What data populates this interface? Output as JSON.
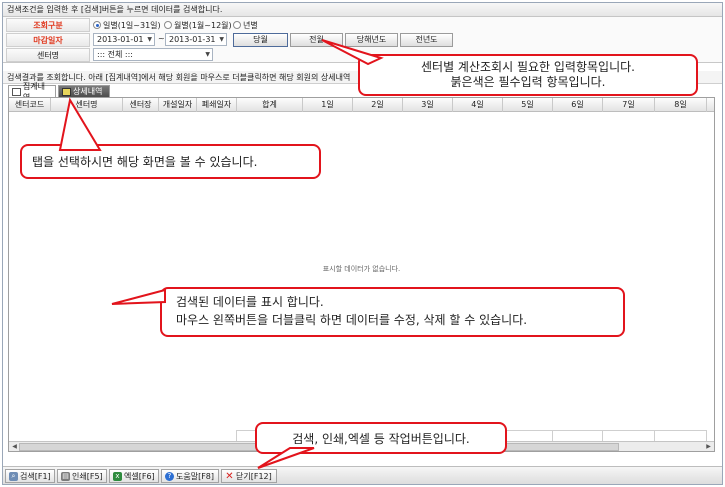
{
  "header": {
    "instruction": "검색조건을 입력한 후 [검색]버튼을 누르면 데이터를 검색합니다."
  },
  "search": {
    "period_type_label": "조회구분",
    "period_options": [
      "일별(1일~31일)",
      "월별(1월~12월)",
      "년별"
    ],
    "selected_period": "일별(1일~31일)",
    "close_date_label": "마감일자",
    "date_from": "2013-01-01",
    "date_separator": "~",
    "date_to": "2013-01-31",
    "quick_buttons": [
      "당월",
      "전월",
      "당해년도",
      "전년도"
    ],
    "center_label": "센터명",
    "center_value": "::: 전체 :::"
  },
  "result": {
    "info": "검색결과를 조회합니다. 아래 [집계내역]에서 해당 회원을 마우스로 더블클릭하면 해당 회원의 상세내역"
  },
  "tabs": [
    {
      "label": "집계내역",
      "active": true
    },
    {
      "label": "상세내역",
      "active": false
    }
  ],
  "grid": {
    "columns": [
      "센터코드",
      "센터명",
      "센터장",
      "개설일자",
      "폐쇄일자",
      "합계",
      "1일",
      "2일",
      "3일",
      "4일",
      "5일",
      "6일",
      "7일",
      "8일"
    ],
    "empty_message": "표시할 데이터가 없습니다."
  },
  "toolbar": {
    "buttons": [
      {
        "label": "검색[F1]",
        "icon": "search-icon"
      },
      {
        "label": "인쇄[F5]",
        "icon": "print-icon"
      },
      {
        "label": "엑셀[F6]",
        "icon": "excel-icon"
      },
      {
        "label": "도움말[F8]",
        "icon": "help-icon"
      },
      {
        "label": "닫기[F12]",
        "icon": "close-icon"
      }
    ]
  },
  "callouts": {
    "input": [
      "센터별 계산조회시 필요한 입력항목입니다.",
      "붉은색은 필수입력 항목입니다."
    ],
    "tab": "탭을 선택하시면 해당 화면을 볼 수 있습니다.",
    "data": [
      "검색된 데이터를 표시 합니다.",
      "마우스 왼쪽버튼을 더블클릭 하면 데이터를 수정, 삭제 할 수 있습니다."
    ],
    "toolbar": "검색, 인쇄,엑셀 등 작업버튼입니다."
  },
  "colors": {
    "required_label": "#e0371d",
    "callout_border": "#e2141c"
  }
}
